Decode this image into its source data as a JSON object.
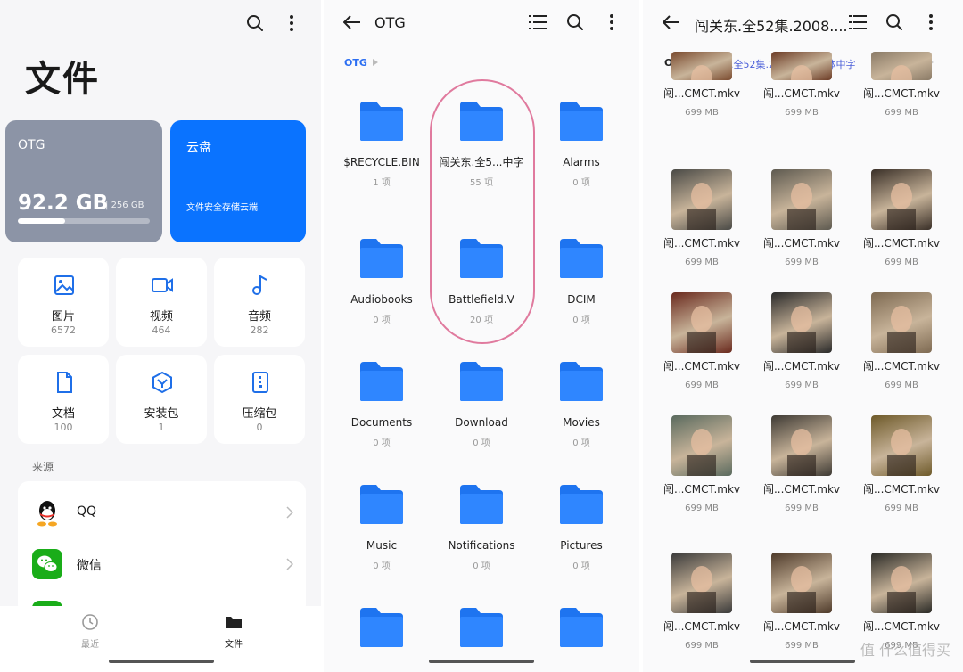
{
  "panel1": {
    "title": "文件",
    "otg": {
      "name": "OTG",
      "used": "92.2 GB",
      "total": "256 GB",
      "used_fraction": 0.36
    },
    "cloud": {
      "name": "云盘",
      "desc": "文件安全存储云端"
    },
    "categories": [
      {
        "label": "图片",
        "count": "6572",
        "icon": "image-icon"
      },
      {
        "label": "视频",
        "count": "464",
        "icon": "video-icon"
      },
      {
        "label": "音频",
        "count": "282",
        "icon": "music-icon"
      },
      {
        "label": "文档",
        "count": "100",
        "icon": "document-icon"
      },
      {
        "label": "安装包",
        "count": "1",
        "icon": "package-icon"
      },
      {
        "label": "压缩包",
        "count": "0",
        "icon": "archive-icon"
      }
    ],
    "sources_title": "来源",
    "sources": [
      {
        "label": "QQ",
        "icon": "qq-icon"
      },
      {
        "label": "微信",
        "icon": "wechat-icon"
      }
    ],
    "nav": [
      {
        "label": "最近",
        "icon": "clock-icon"
      },
      {
        "label": "文件",
        "icon": "folder-icon"
      }
    ]
  },
  "panel2": {
    "title": "OTG",
    "breadcrumb": "OTG",
    "folders": [
      {
        "name": "$RECYCLE.BIN",
        "count": "1 项"
      },
      {
        "name": "闯关东.全5...中字",
        "count": "55 项"
      },
      {
        "name": "Alarms",
        "count": "0 项"
      },
      {
        "name": "Audiobooks",
        "count": "0 项"
      },
      {
        "name": "Battlefield.V",
        "count": "20 项"
      },
      {
        "name": "DCIM",
        "count": "0 项"
      },
      {
        "name": "Documents",
        "count": "0 项"
      },
      {
        "name": "Download",
        "count": "0 项"
      },
      {
        "name": "Movies",
        "count": "0 项"
      },
      {
        "name": "Music",
        "count": "0 项"
      },
      {
        "name": "Notifications",
        "count": "0 项"
      },
      {
        "name": "Pictures",
        "count": "0 项"
      },
      {
        "name": "",
        "count": ""
      },
      {
        "name": "",
        "count": ""
      },
      {
        "name": "",
        "count": ""
      }
    ]
  },
  "panel3": {
    "title": "闯关东.全52集.2008....",
    "breadcrumb_root": "OTG",
    "breadcrumb_current": "关东.全52集.2008.内嵌简体中字",
    "file_name": "闯...CMCT.mkv",
    "file_size": "699 MB",
    "thumb_colors": [
      "#7a4a2e",
      "#6b3a24",
      "#8a7a66",
      "#4a4a46",
      "#5e5a50",
      "#3a3028",
      "#6a2a1e",
      "#2a2a2a",
      "#7e6a52",
      "#5a6a5e",
      "#3e3a34",
      "#6e5a2a",
      "#3a3a3a",
      "#4e3a2a",
      "#2a2a26"
    ]
  },
  "watermark": "值 什么值得买"
}
